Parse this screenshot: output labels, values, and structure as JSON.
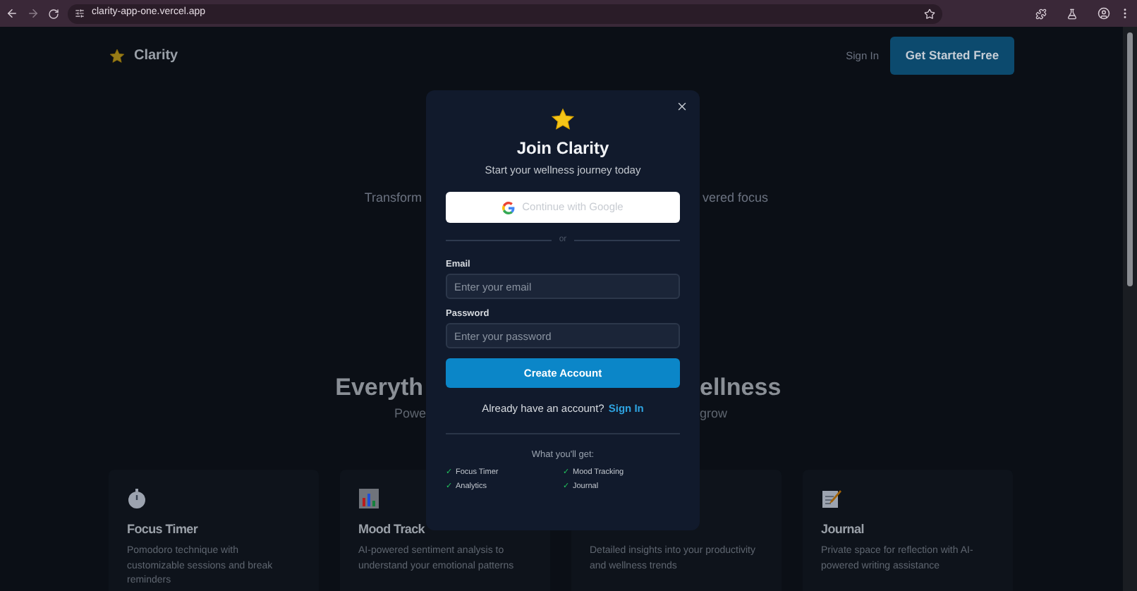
{
  "browser": {
    "url": "clarity-app-one.vercel.app"
  },
  "nav": {
    "logo": "Clarity",
    "sign_in": "Sign In",
    "cta": "Get Started Free"
  },
  "hero": {
    "tagline_left": "Transform",
    "tagline_right": "vered focus",
    "heading_left": "Everyth",
    "heading_right": "ellness",
    "subtitle_left": "Powe",
    "subtitle_right": "grow"
  },
  "features": [
    {
      "title": "Focus Timer",
      "description": "Pomodoro technique with customizable sessions and break reminders"
    },
    {
      "title": "Mood Track",
      "description": "AI-powered sentiment analysis to understand your emotional patterns"
    },
    {
      "description": "Detailed insights into your productivity and wellness trends"
    },
    {
      "title": "Journal",
      "description": "Private space for reflection with AI-powered writing assistance"
    }
  ],
  "modal": {
    "title": "Join Clarity",
    "subtitle": "Start your wellness journey today",
    "google_button": "Continue with Google",
    "divider_text": "or",
    "fields": [
      {
        "label": "Email",
        "placeholder": "Enter your email"
      },
      {
        "label": "Password",
        "placeholder": "Enter your password"
      }
    ],
    "submit": "Create Account",
    "signin_prompt": "Already have an account?",
    "signin_link": "Sign In",
    "perks_title": "What you'll get:",
    "perks": [
      {
        "mark": "✓",
        "label": "Focus Timer"
      },
      {
        "mark": "✓",
        "label": "Mood Tracking"
      },
      {
        "mark": "✓",
        "label": "Analytics"
      },
      {
        "mark": "✓",
        "label": "Journal"
      }
    ]
  }
}
